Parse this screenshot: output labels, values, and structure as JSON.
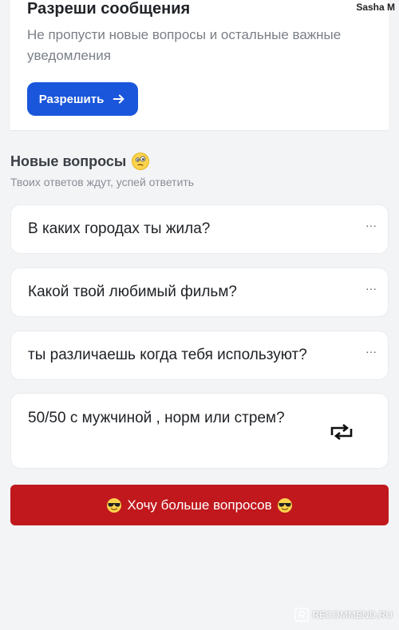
{
  "notification": {
    "title": "Разреши сообщения",
    "text": "Не пропусти новые вопросы и остальные важные уведомления",
    "allow_label": "Разрешить"
  },
  "user": {
    "name": "Sasha M"
  },
  "section": {
    "title": "Новые вопросы",
    "subtitle": "Твоих ответов ждут, успей ответить"
  },
  "questions": [
    {
      "text": "В каких городах ты жила?",
      "menu": "···"
    },
    {
      "text": "Какой твой любимый фильм?",
      "menu": "···"
    },
    {
      "text": "ты различаешь когда тебя используют?",
      "menu": "···"
    },
    {
      "text": "50/50 с мужчиной , норм или стрем?"
    }
  ],
  "more_button": {
    "label": "Хочу больше вопросов"
  },
  "watermark": {
    "text": "RECOMMEND.RU"
  },
  "colors": {
    "primary": "#1a56db",
    "danger": "#c0181d",
    "background": "#f3f4f6"
  }
}
